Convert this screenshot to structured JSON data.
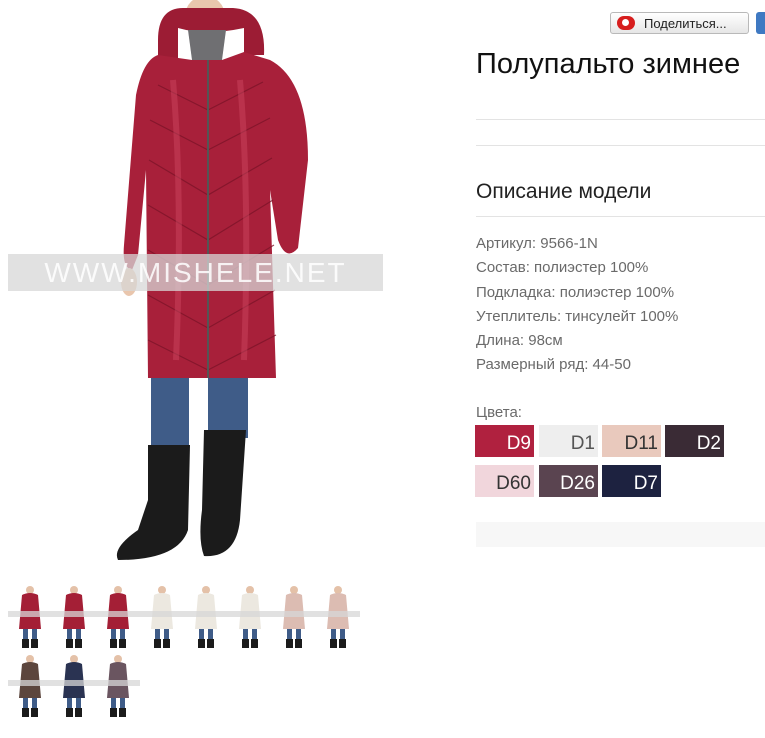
{
  "share": {
    "label": "Поделиться..."
  },
  "product": {
    "title": "Полупальто зимнее"
  },
  "main_image": {
    "watermark": "WWW.MISHELE.NET"
  },
  "description": {
    "heading": "Описание модели",
    "specs": [
      "Артикул: 9566-1N",
      "Состав: полиэстер 100%",
      "Подкладка: полиэстер 100%",
      "Утеплитель: тинсулейт 100%",
      "Длина: 98см",
      "Размерный ряд: 44-50"
    ]
  },
  "colors": {
    "label": "Цвета:",
    "swatches": [
      {
        "code": "D9",
        "color": "#b0213f",
        "text_color": "#ffffff"
      },
      {
        "code": "D1",
        "color": "#eeeeee",
        "text_color": "#555555"
      },
      {
        "code": "D11",
        "color": "#e9c9bd",
        "text_color": "#333333"
      },
      {
        "code": "D2",
        "color": "#3a2b35",
        "text_color": "#ffffff"
      },
      {
        "code": "D60",
        "color": "#f1d6dc",
        "text_color": "#333333"
      },
      {
        "code": "D26",
        "color": "#5a4450",
        "text_color": "#ffffff"
      },
      {
        "code": "D7",
        "color": "#1d2240",
        "text_color": "#ffffff"
      }
    ]
  },
  "thumbnails": [
    {
      "name": "thumb-burgundy-1",
      "coat": "#a41f36"
    },
    {
      "name": "thumb-burgundy-2",
      "coat": "#a41f36"
    },
    {
      "name": "thumb-burgundy-3",
      "coat": "#a41f36"
    },
    {
      "name": "thumb-white-1",
      "coat": "#ece8e0"
    },
    {
      "name": "thumb-white-2",
      "coat": "#ece8e0"
    },
    {
      "name": "thumb-white-3",
      "coat": "#ece8e0"
    },
    {
      "name": "thumb-beige-1",
      "coat": "#dcbcb2"
    },
    {
      "name": "thumb-beige-2",
      "coat": "#dcbcb2"
    },
    {
      "name": "thumb-brown",
      "coat": "#5c463d"
    },
    {
      "name": "thumb-navy",
      "coat": "#2a3352"
    },
    {
      "name": "thumb-plum",
      "coat": "#6a5560"
    }
  ]
}
